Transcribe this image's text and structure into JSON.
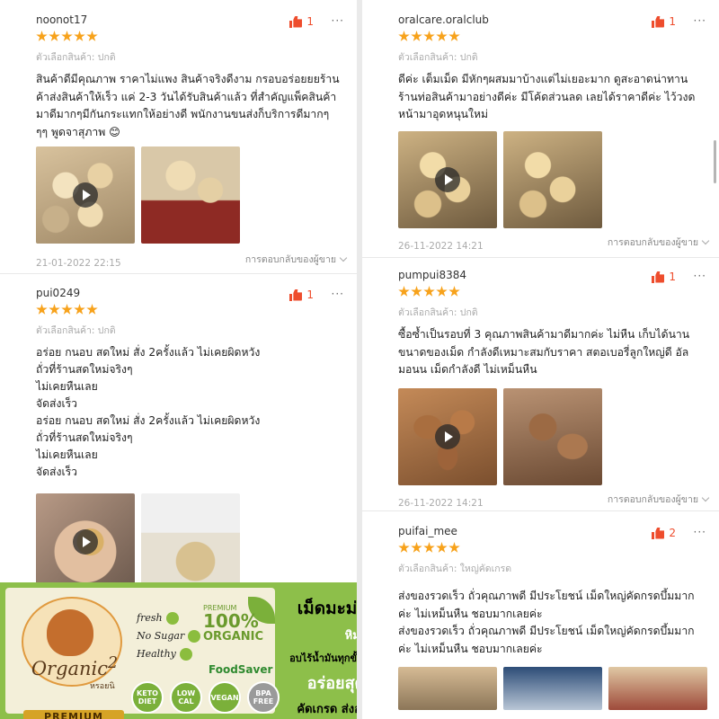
{
  "reviews_left": [
    {
      "username": "noonot17",
      "variant": "ตัวเลือกสินค้า: ปกติ",
      "body": "สินค้าดีมีคุณภาพ ราคาไม่แพง สินค้าจริงดีงาม กรอบอร่อยยยร้านค้าส่งสินค้าให้เร็ว แค่ 2-3 วันได้รับสินค้าแล้ว ที่สำคัญแพ็คสินค้ามาดีมากๆมีกันกระแทกให้อย่างดี พนักงานขนส่งก็บริการดีมากๆ ๆๆ พูดจาสุภาพ 😊",
      "date": "21-01-2022 22:15",
      "likes": "1",
      "reply_label": "การตอบกลับของผู้ขาย"
    },
    {
      "username": "pui0249",
      "variant": "ตัวเลือกสินค้า: ปกติ",
      "body": "อร่อย กนอบ สดใหม่ สั่ง 2ครั้งแล้ว ไม่เคยผิดหวัง\nถั่วที่ร้านสดใหม่จริงๆ\nไม่เคยหืนเลย\nจัดส่งเร็ว\nอร่อย กนอบ สดใหม่ สั่ง 2ครั้งแล้ว ไม่เคยผิดหวัง\nถั่วที่ร้านสดใหม่จริงๆ\nไม่เคยหืนเลย\nจัดส่งเร็ว",
      "likes": "1"
    }
  ],
  "reviews_right": [
    {
      "username": "oralcare.oralclub",
      "variant": "ตัวเลือกสินค้า: ปกติ",
      "body": "ดีค่ะ เต็มเม็ด มีหักๆผสมมาบ้างแต่ไม่เยอะมาก ดูสะอาดน่าทานร้านท่อสินค้ามาอย่างดีค่ะ มีโค้ดส่วนลด เลยได้ราคาดีค่ะ ไว้วงดหน้ามาอุดหนุนใหม่",
      "date": "26-11-2022 14:21",
      "likes": "1",
      "reply_label": "การตอบกลับของผู้ขาย"
    },
    {
      "username": "pumpui8384",
      "variant": "ตัวเลือกสินค้า: ปกติ",
      "body": "ซื้อซ้ำเป็นรอบที่ 3 คุณภาพสินค้ามาดีมากค่ะ ไม่หืน เก็บได้นานขนาดของเม็ด กำลังดีเหมาะสมกับราคา สตอเบอรี่ลูกใหญ่ดี อัลมอนน เม็ดกำลังดี ไม่เหม็นหืน",
      "date": "26-11-2022 14:21",
      "likes": "1",
      "reply_label": "การตอบกลับของผู้ขาย"
    },
    {
      "username": "puifai_mee",
      "variant": "ตัวเลือกสินค้า: ใหญ่คัดเกรด",
      "body": "ส่งของรวดเร็ว ถั่วคุณภาพดี มีประโยชน์ เม็ดใหญ่คัดกรดบึ้มมากค่ะ ไม่เหม็นหืน ชอบมากเลยค่ะ\nส่งของรวดเร็ว ถั่วคุณภาพดี มีประโยชน์ เม็ดใหญ่คัดกรดบึ้มมากค่ะ ไม่เหม็นหืน ชอบมากเลยค่ะ",
      "likes": "2"
    }
  ],
  "more_label": "···",
  "banner": {
    "brand": "Organic",
    "brand_num": "2",
    "brand_thai": "หรอยนิ",
    "premium": "PREMIUM",
    "claims": [
      "fresh",
      "No Sugar",
      "Healthy"
    ],
    "org_premium": "PREMIUM",
    "org_pct": "100%",
    "org_word": "ORGANIC",
    "foodsaver": "FoodSaver",
    "badges": [
      "KETO DIET",
      "LOW CAL",
      "VEGAN",
      "BPA FREE"
    ],
    "title": "เม็ดมะม่วง",
    "sub1": "หิมพานต์",
    "sub2": "อบไร้น้ำมันทุกขั้นตอน",
    "sub3": "อร่อยสุด",
    "sub4": "คัดเกรด ส่งออก"
  },
  "colors": {
    "star": "#f7a21b",
    "like": "#ee4d2d",
    "banner_green": "#8dbf4a"
  }
}
